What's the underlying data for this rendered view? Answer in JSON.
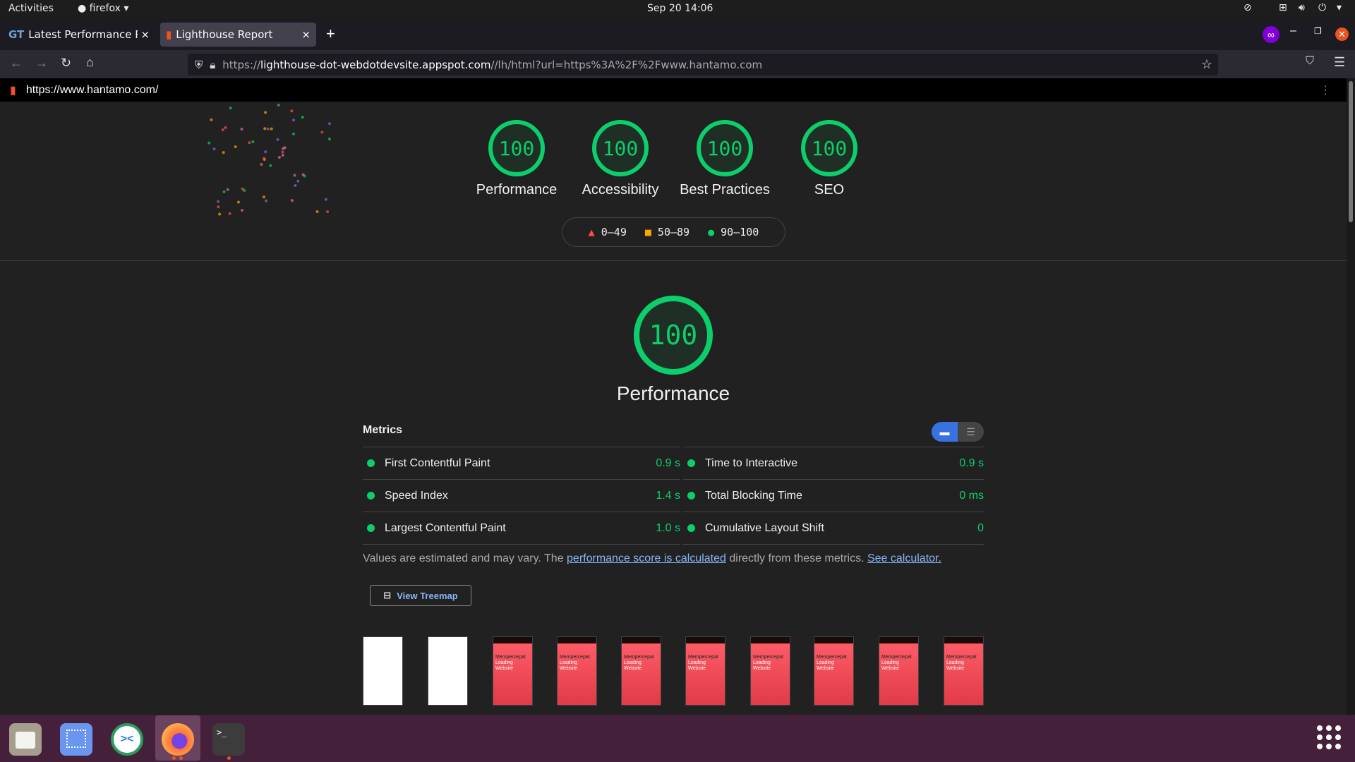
{
  "system": {
    "activities": "Activities",
    "app": "firefox",
    "datetime": "Sep 20  14:06"
  },
  "tabs": [
    {
      "label": "Latest Performance Repo",
      "active": false
    },
    {
      "label": "Lighthouse Report",
      "active": true
    }
  ],
  "address": {
    "url_prefix": "https://",
    "url_host": "lighthouse-dot-webdotdevsite.appspot.com",
    "url_rest": "//lh/html?url=https%3A%2F%2Fwww.hantamo.com"
  },
  "report": {
    "tested_url": "https://www.hantamo.com/",
    "categories": [
      {
        "label": "Performance",
        "score": "100"
      },
      {
        "label": "Accessibility",
        "score": "100"
      },
      {
        "label": "Best Practices",
        "score": "100"
      },
      {
        "label": "SEO",
        "score": "100"
      }
    ],
    "legend": [
      {
        "range": "0–49",
        "shape": "triangle",
        "color": "#ff4e42"
      },
      {
        "range": "50–89",
        "shape": "square",
        "color": "#ffa400"
      },
      {
        "range": "90–100",
        "shape": "circle",
        "color": "#0cce6b"
      }
    ],
    "main_score": "100",
    "main_label": "Performance",
    "metrics_title": "Metrics",
    "metrics": [
      {
        "label": "First Contentful Paint",
        "value": "0.9 s"
      },
      {
        "label": "Time to Interactive",
        "value": "0.9 s"
      },
      {
        "label": "Speed Index",
        "value": "1.4 s"
      },
      {
        "label": "Total Blocking Time",
        "value": "0 ms"
      },
      {
        "label": "Largest Contentful Paint",
        "value": "1.0 s"
      },
      {
        "label": "Cumulative Layout Shift",
        "value": "0"
      }
    ],
    "note_pre": "Values are estimated and may vary. The ",
    "note_link1": "performance score is calculated",
    "note_mid": " directly from these metrics. ",
    "note_link2": "See calculator.",
    "treemap_label": "View Treemap",
    "filmstrip_text": [
      "Mempercepat",
      "Loading",
      "Website"
    ]
  },
  "colors": {
    "pass": "#0cce6b",
    "accent": "#3871e0",
    "taskbar": "#45203a"
  }
}
